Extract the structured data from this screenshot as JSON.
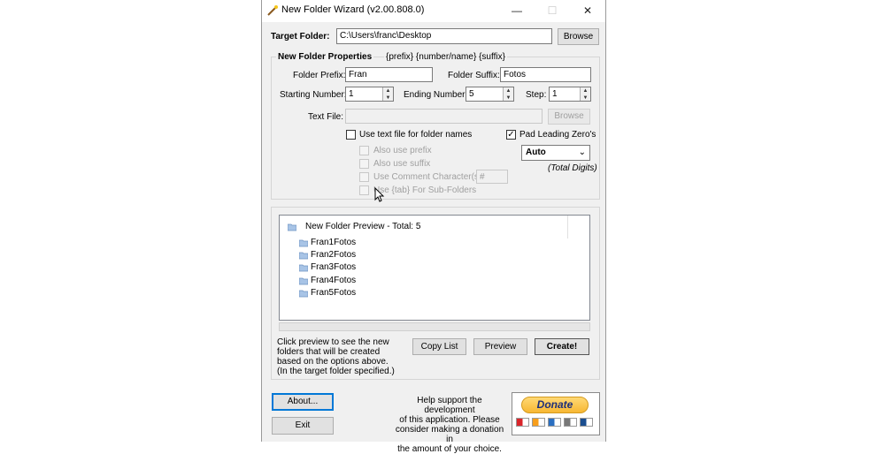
{
  "window": {
    "title": "New Folder Wizard  (v2.00.808.0)",
    "minimize": "—",
    "maximize": "☐",
    "close": "✕"
  },
  "target": {
    "label": "Target Folder:",
    "value": "C:\\Users\\franc\\Desktop",
    "browse": "Browse"
  },
  "properties": {
    "title": "New Folder Properties",
    "pattern": "{prefix} {number/name} {suffix}",
    "prefix_label": "Folder Prefix:",
    "prefix_value": "Fran",
    "suffix_label": "Folder Suffix:",
    "suffix_value": "Fotos",
    "start_label": "Starting Number:",
    "start_value": "1",
    "end_label": "Ending Number:",
    "end_value": "5",
    "step_label": "Step:",
    "step_value": "1",
    "textfile_label": "Text File:",
    "textfile_value": "",
    "textfile_browse": "Browse",
    "use_textfile": "Use text file for folder names",
    "use_textfile_checked": false,
    "pad_zeros": "Pad Leading Zero's",
    "pad_zeros_checked": true,
    "also_prefix": "Also use prefix",
    "also_suffix": "Also use suffix",
    "use_comment": "Use Comment Character(s):",
    "comment_value": "#",
    "use_tab": "Use {tab} For Sub-Folders",
    "digits_value": "Auto",
    "digits_caption": "(Total Digits)"
  },
  "preview": {
    "root": "New Folder Preview - Total: 5",
    "items": [
      "Fran1Fotos",
      "Fran2Fotos",
      "Fran3Fotos",
      "Fran4Fotos",
      "Fran5Fotos"
    ],
    "help_lines": [
      "Click preview to see the new",
      "folders that will be created",
      "based on the options above.",
      "(In the target folder specified.)"
    ],
    "copy_list": "Copy List",
    "preview": "Preview",
    "create": "Create!"
  },
  "footer": {
    "about": "About...",
    "exit": "Exit",
    "support_lines": [
      "Help support the development",
      "of this application. Please",
      "consider making a donation in",
      "the amount of your choice."
    ],
    "donate": "Donate",
    "card_colors": [
      "#d9252a",
      "#f79e1b",
      "#2a6fc1",
      "#777777",
      "#1a4d8f"
    ]
  }
}
